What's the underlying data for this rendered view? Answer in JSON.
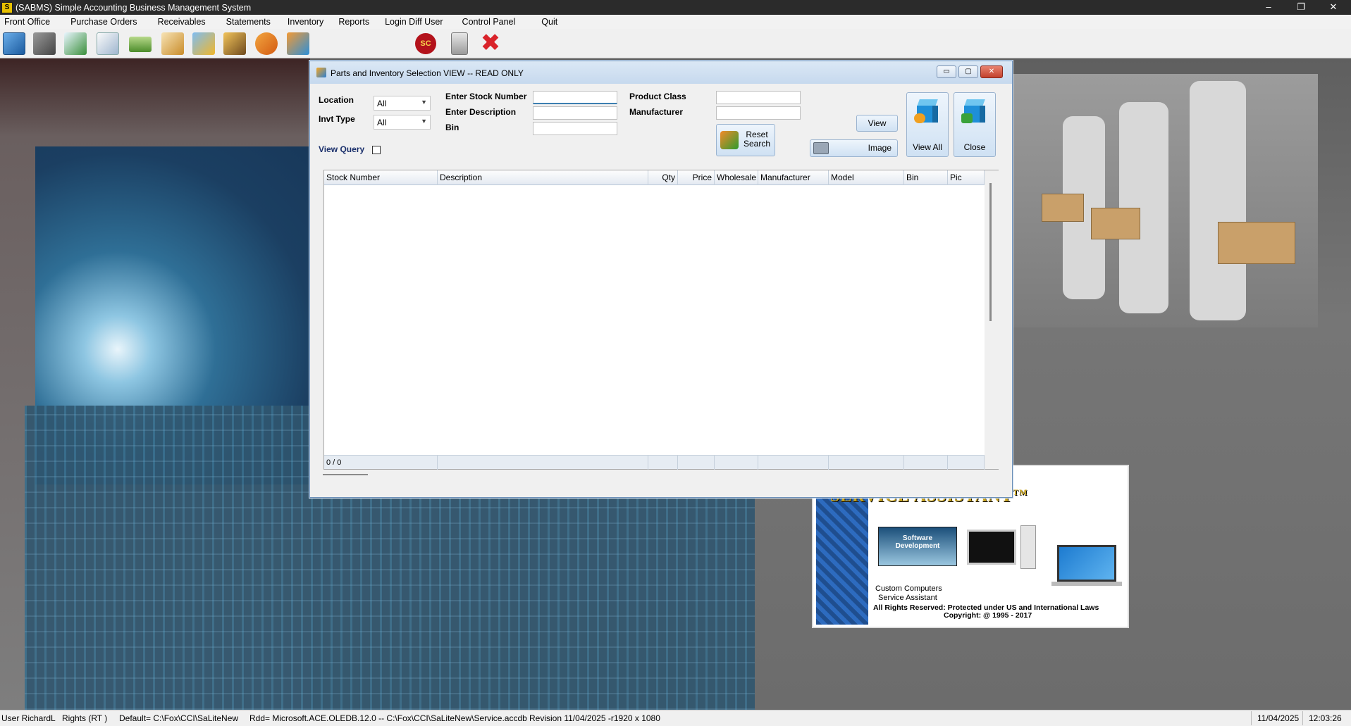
{
  "window": {
    "title": "(SABMS) Simple Accounting Business Management System",
    "icon_label": "S",
    "controls": {
      "minimize": "–",
      "restore": "❐",
      "close": "✕"
    }
  },
  "menu": {
    "items": [
      "Front Office",
      "Purchase Orders",
      "Receivables",
      "Statements",
      "Inventory",
      "Reports",
      "Login Diff User",
      "Control Panel",
      "Quit"
    ]
  },
  "toolbar": {
    "icons": [
      "compass-icon",
      "tools-icon",
      "checklist-icon",
      "document-icon",
      "money-icon",
      "report-icon",
      "folder-edit-icon",
      "users-icon",
      "handshake-icon",
      "cube-icon",
      "sc-badge-icon",
      "calculator-icon",
      "exit-x-icon"
    ],
    "sc_label": "SC"
  },
  "dialog": {
    "title": "Parts and Inventory Selection  VIEW -- READ ONLY",
    "controls": {
      "minimize": "▭",
      "maximize": "▢",
      "close": "✕"
    },
    "filters": {
      "location_label": "Location",
      "location_value": "All",
      "invt_type_label": "Invt Type",
      "invt_type_value": "All",
      "view_query_label": "View Query",
      "stock_number_label": "Enter Stock Number",
      "stock_number_value": "",
      "description_label": "Enter Description",
      "description_value": "",
      "bin_label": "Bin",
      "bin_value": "",
      "product_class_label": "Product Class",
      "product_class_value": "",
      "manufacturer_label": "Manufacturer",
      "manufacturer_value": ""
    },
    "buttons": {
      "reset_line1": "Reset",
      "reset_line2": "Search",
      "view": "View",
      "image": "Image",
      "view_all": "View All",
      "close": "Close"
    },
    "grid": {
      "columns": [
        "Stock Number",
        "Description",
        "Qty",
        "Price",
        "Wholesale",
        "Manufacturer",
        "Model",
        "Bin",
        "Pic"
      ],
      "rows": [],
      "footer_count": "0 / 0"
    }
  },
  "background": {
    "service_assistant_title": "SERVICE ASSISTANT",
    "trademark": "TM",
    "software_dev_line1": "Software",
    "software_dev_line2": "Development",
    "line1": "Custom Computers",
    "line2": "Service Assistant",
    "line3": "All Rights Reserved: Protected under US and International Laws",
    "line4": "Copyright: @ 1995 - 2017"
  },
  "statusbar": {
    "user": "User  RichardL",
    "rights": "Rights  (RT )",
    "default": "Default= C:\\Fox\\CCI\\SaLiteNew",
    "rdd": "Rdd= Microsoft.ACE.OLEDB.12.0 -- C:\\Fox\\CCI\\SaLiteNew\\Service.accdb",
    "revision": "Revision  11/04/2025  -r1920 x 1080",
    "date": "11/04/2025",
    "time": "12:03:26"
  },
  "colors": {
    "titlebar": "#2b2b2b",
    "dialog_title": "#c6d9ee",
    "close_button": "#c2412d",
    "exit_icon": "#d9232a",
    "sc_badge": "#b3121b"
  }
}
